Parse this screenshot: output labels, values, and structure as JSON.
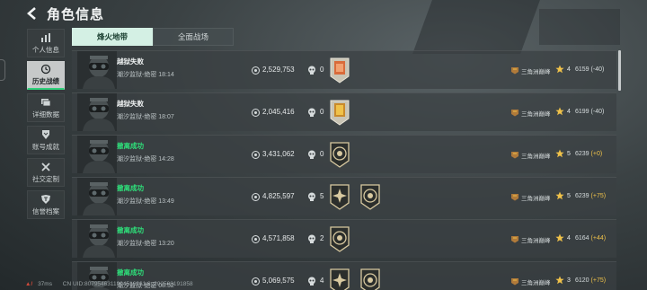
{
  "header": {
    "title": "角色信息"
  },
  "sidebar": {
    "items": [
      {
        "label": "个人信息",
        "icon": "bar-chart-icon",
        "active": false
      },
      {
        "label": "历史战绩",
        "icon": "history-icon",
        "active": true
      },
      {
        "label": "详细数据",
        "icon": "data-icon",
        "active": false
      },
      {
        "label": "账号成就",
        "icon": "achievement-icon",
        "active": false
      },
      {
        "label": "社交定制",
        "icon": "tools-icon",
        "active": false
      },
      {
        "label": "信誉档案",
        "icon": "shield-icon",
        "active": false
      }
    ]
  },
  "tabs": [
    {
      "label": "烽火地带",
      "active": true
    },
    {
      "label": "全面战场",
      "active": false
    }
  ],
  "matches": [
    {
      "result": "越狱失败",
      "success": false,
      "map_time": "潮汐监狱-绝密 18:14",
      "money": "2,529,753",
      "kills": "0",
      "badges": [
        "orange-shield-badge"
      ],
      "rank": "三角洲巅峰",
      "stars": "4",
      "score": "6159",
      "delta": "(-40)",
      "delta_sign": "neg"
    },
    {
      "result": "越狱失败",
      "success": false,
      "map_time": "潮汐监狱-绝密 18:07",
      "money": "2,045,416",
      "kills": "0",
      "badges": [
        "gold-shield-badge"
      ],
      "rank": "三角洲巅峰",
      "stars": "4",
      "score": "6199",
      "delta": "(-40)",
      "delta_sign": "neg"
    },
    {
      "result": "撤离成功",
      "success": true,
      "map_time": "潮汐监狱-绝密 14:28",
      "money": "3,431,062",
      "kills": "0",
      "badges": [
        "evac-badge"
      ],
      "rank": "三角洲巅峰",
      "stars": "5",
      "score": "6239",
      "delta": "(+0)",
      "delta_sign": "pos"
    },
    {
      "result": "撤离成功",
      "success": true,
      "map_time": "潮汐监狱-绝密 13:49",
      "money": "4,825,597",
      "kills": "5",
      "badges": [
        "combat-badge",
        "evac-badge"
      ],
      "rank": "三角洲巅峰",
      "stars": "5",
      "score": "6239",
      "delta": "(+75)",
      "delta_sign": "pos"
    },
    {
      "result": "撤离成功",
      "success": true,
      "map_time": "潮汐监狱-绝密 13:20",
      "money": "4,571,858",
      "kills": "2",
      "badges": [
        "evac-badge"
      ],
      "rank": "三角洲巅峰",
      "stars": "4",
      "score": "6164",
      "delta": "(+44)",
      "delta_sign": "pos"
    },
    {
      "result": "撤离成功",
      "success": true,
      "map_time": "潮汐监狱-绝密 08:52",
      "money": "5,069,575",
      "kills": "4",
      "badges": [
        "combat-badge",
        "evac-badge"
      ],
      "rank": "三角洲巅峰",
      "stars": "3",
      "score": "6120",
      "delta": "(+75)",
      "delta_sign": "pos"
    }
  ],
  "footer": {
    "ping": "37ms",
    "uid": "CN UID:8079546311904516261 3_202508191858"
  },
  "colors": {
    "success": "#2ee07a",
    "accent": "#2fd07a",
    "delta_positive": "#f0c24a"
  }
}
